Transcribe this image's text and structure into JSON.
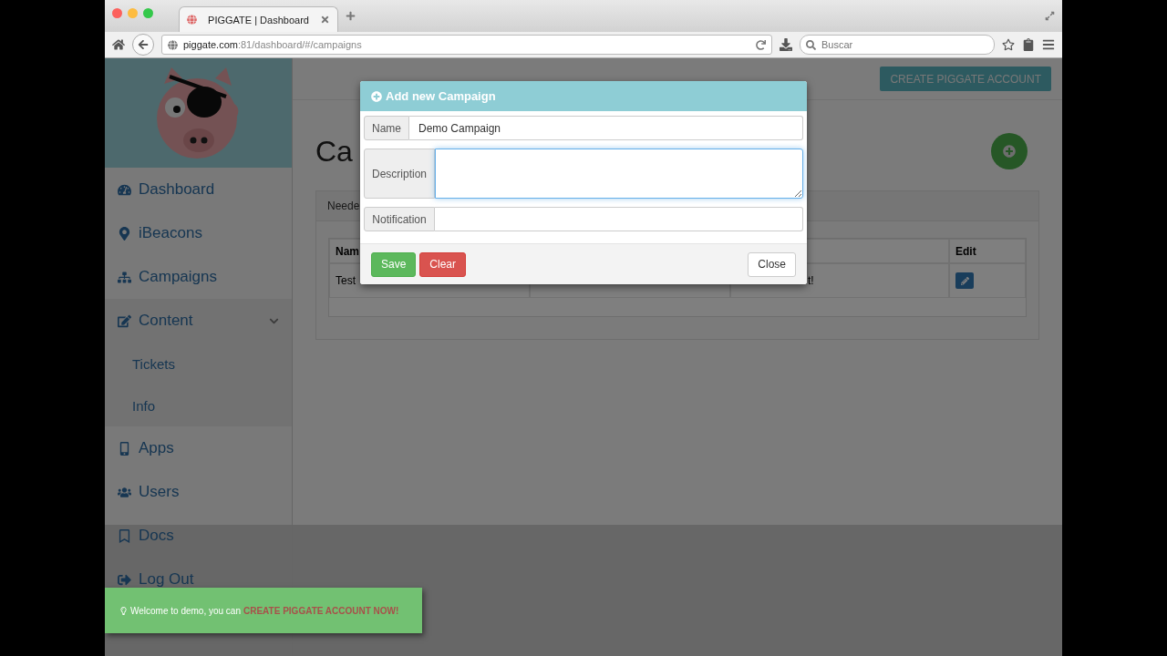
{
  "browser": {
    "tab_title": "PIGGATE | Dashboard",
    "url_host": "piggate.com",
    "url_path": ":81/dashboard/#/campaigns",
    "search": {
      "placeholder": "Buscar"
    }
  },
  "sidebar": {
    "items": [
      {
        "label": "Dashboard"
      },
      {
        "label": "iBeacons"
      },
      {
        "label": "Campaigns"
      },
      {
        "label": "Content",
        "expanded": true,
        "children": [
          {
            "label": "Tickets"
          },
          {
            "label": "Info"
          }
        ]
      },
      {
        "label": "Apps"
      },
      {
        "label": "Users"
      },
      {
        "label": "Docs"
      },
      {
        "label": "Log Out"
      }
    ]
  },
  "main": {
    "top_button": "CREATE PIGGATE ACCOUNT",
    "heading": "Ca",
    "panel_header": "Neede",
    "table": {
      "columns": [
        "Nam",
        "Edit"
      ],
      "rows": [
        {
          "cells": [
            "Test",
            "t!"
          ]
        }
      ]
    }
  },
  "modal": {
    "title": "Add new Campaign",
    "fields": [
      {
        "kind": "input",
        "label": "Name",
        "value": "Demo Campaign",
        "focused": false
      },
      {
        "kind": "textarea",
        "label": "Description",
        "focused": true
      },
      {
        "kind": "input",
        "label": "Notification",
        "focused": false
      }
    ],
    "buttons": [
      {
        "label": "Save",
        "kind": "success"
      },
      {
        "label": "Clear",
        "kind": "danger"
      },
      {
        "label": "Close",
        "kind": "default"
      }
    ]
  },
  "toast": {
    "text": "Welcome to demo, you can",
    "link": "CREATE PIGGATE ACCOUNT NOW!"
  }
}
